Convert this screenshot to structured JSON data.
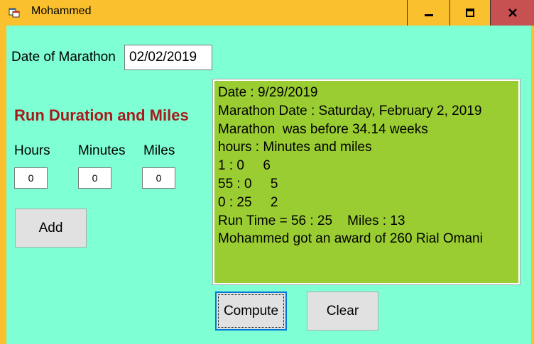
{
  "window": {
    "title": "Mohammed",
    "colors": {
      "frame": "#FBC02D",
      "client": "#7FFFD4",
      "output_bg": "#9ACD32",
      "heading": "#A51C1C",
      "close_bg": "#C75050"
    },
    "controls": {
      "minimize_icon": "minimize-icon",
      "maximize_icon": "maximize-icon",
      "close_icon": "close-icon"
    }
  },
  "form": {
    "date_label": "Date of Marathon",
    "date_value": "02/02/2019",
    "section_title": "Run Duration and Miles",
    "hours_label": "Hours",
    "minutes_label": "Minutes",
    "miles_label": "Miles",
    "hours_value": "0",
    "minutes_value": "0",
    "miles_value": "0",
    "add_label": "Add",
    "compute_label": "Compute",
    "clear_label": "Clear"
  },
  "output": {
    "lines": [
      "Date : 9/29/2019",
      "Marathon Date : Saturday, February 2, 2019",
      "Marathon  was before 34.14 weeks",
      "hours : Minutes and miles",
      "1 : 0     6",
      "55 : 0     5",
      "0 : 25     2",
      "Run Time = 56 : 25    Miles : 13",
      "Mohammed got an award of 260 Rial Omani"
    ]
  }
}
